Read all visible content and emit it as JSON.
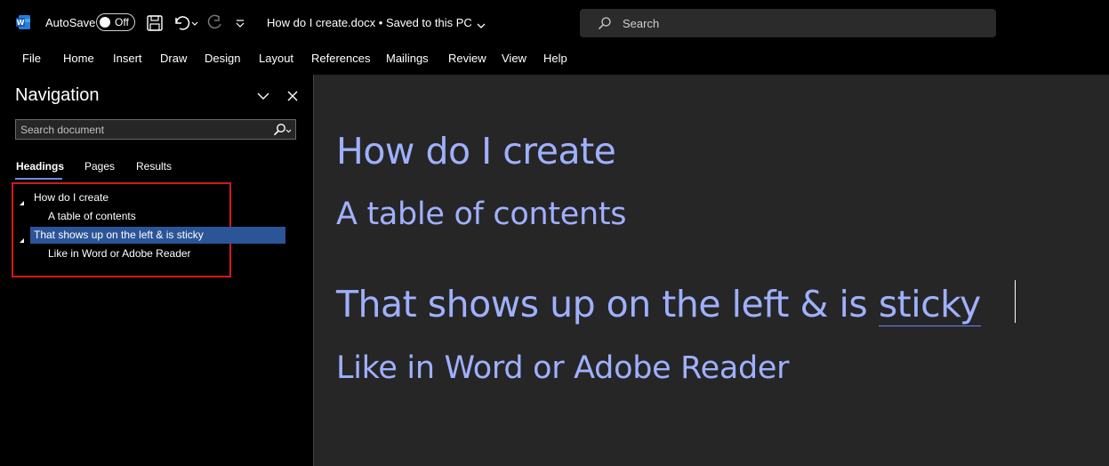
{
  "titlebar": {
    "app_icon": "word-icon",
    "autosave_label": "AutoSave",
    "autosave_state": "Off",
    "doc_name": "How do I create.docx",
    "separator": "•",
    "save_status": "Saved to this PC",
    "search_placeholder": "Search"
  },
  "ribbon": {
    "tabs": [
      "File",
      "Home",
      "Insert",
      "Draw",
      "Design",
      "Layout",
      "References",
      "Mailings",
      "Review",
      "View",
      "Help"
    ]
  },
  "navigation": {
    "title": "Navigation",
    "search_placeholder": "Search document",
    "tabs": [
      "Headings",
      "Pages",
      "Results"
    ],
    "active_tab": "Headings",
    "tree": [
      {
        "label": "How do I create",
        "level": 1,
        "expanded": true,
        "selected": false
      },
      {
        "label": "A table of contents",
        "level": 2,
        "selected": false
      },
      {
        "label": "That shows up on the left & is sticky",
        "level": 1,
        "expanded": true,
        "selected": true
      },
      {
        "label": "Like in Word or Adobe Reader",
        "level": 2,
        "selected": false
      }
    ]
  },
  "document": {
    "headings": [
      {
        "text": "How do I create",
        "style": "Heading 1"
      },
      {
        "text": "A table of contents",
        "style": "Heading 2"
      },
      {
        "text_main": "That shows up on the left & is ",
        "text_flagged": "sticky",
        "style": "Heading 1"
      },
      {
        "text": "Like in Word or Adobe Reader",
        "style": "Heading 2"
      }
    ]
  },
  "colors": {
    "heading_text": "#9fb0ff",
    "selected_nav": "#2c5598",
    "highlight_box": "#d4191b",
    "doc_background": "#262626"
  }
}
